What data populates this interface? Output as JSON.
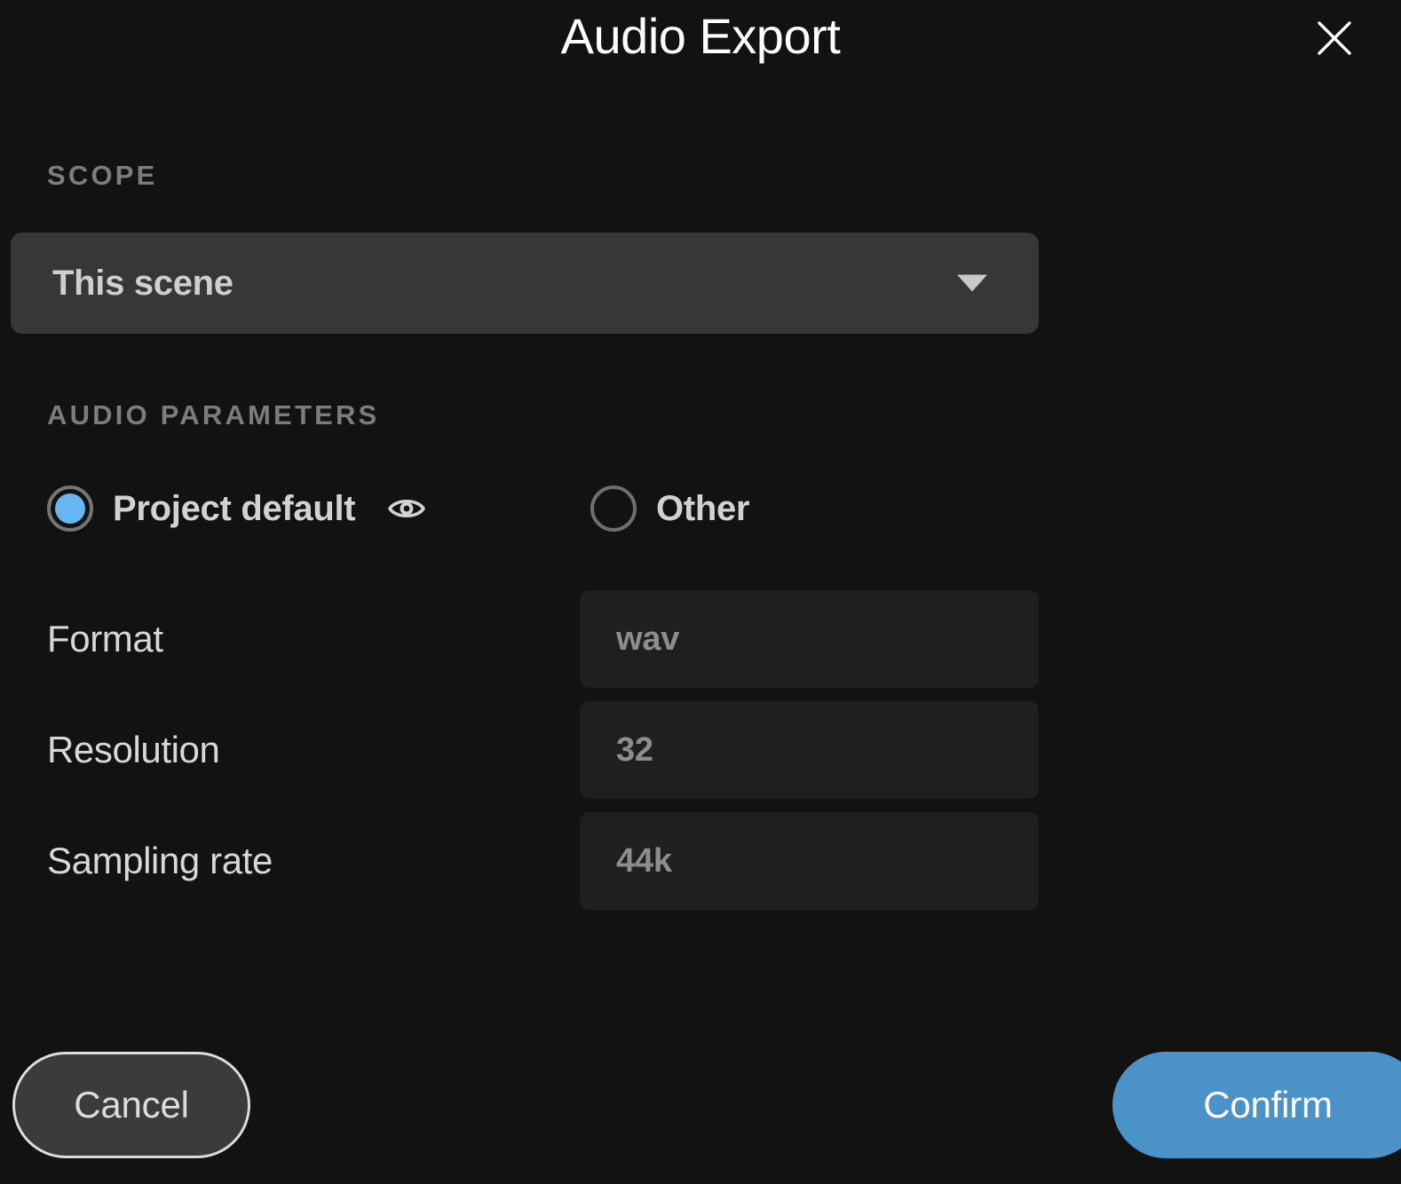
{
  "dialog": {
    "title": "Audio Export",
    "close_icon": "close-icon",
    "background_color": "#121212"
  },
  "scope": {
    "section_label": "SCOPE",
    "dropdown": {
      "selected_value": "This scene",
      "arrow_icon": "chevron-down-icon",
      "background_color": "#373737"
    }
  },
  "audio_parameters": {
    "section_label": "AUDIO PARAMETERS",
    "mode_options": [
      {
        "label": "Project default",
        "selected": true,
        "has_preview_icon": true,
        "preview_icon": "eye-icon",
        "accent_color": "#66b6f2"
      },
      {
        "label": "Other",
        "selected": false,
        "has_preview_icon": false
      }
    ],
    "fields": [
      {
        "name": "Format",
        "value": "wav"
      },
      {
        "name": "Resolution",
        "value": "32"
      },
      {
        "name": "Sampling rate",
        "value": "44k"
      }
    ]
  },
  "footer": {
    "cancel_label": "Cancel",
    "confirm_label": "Confirm",
    "confirm_color": "#4a92c8"
  }
}
